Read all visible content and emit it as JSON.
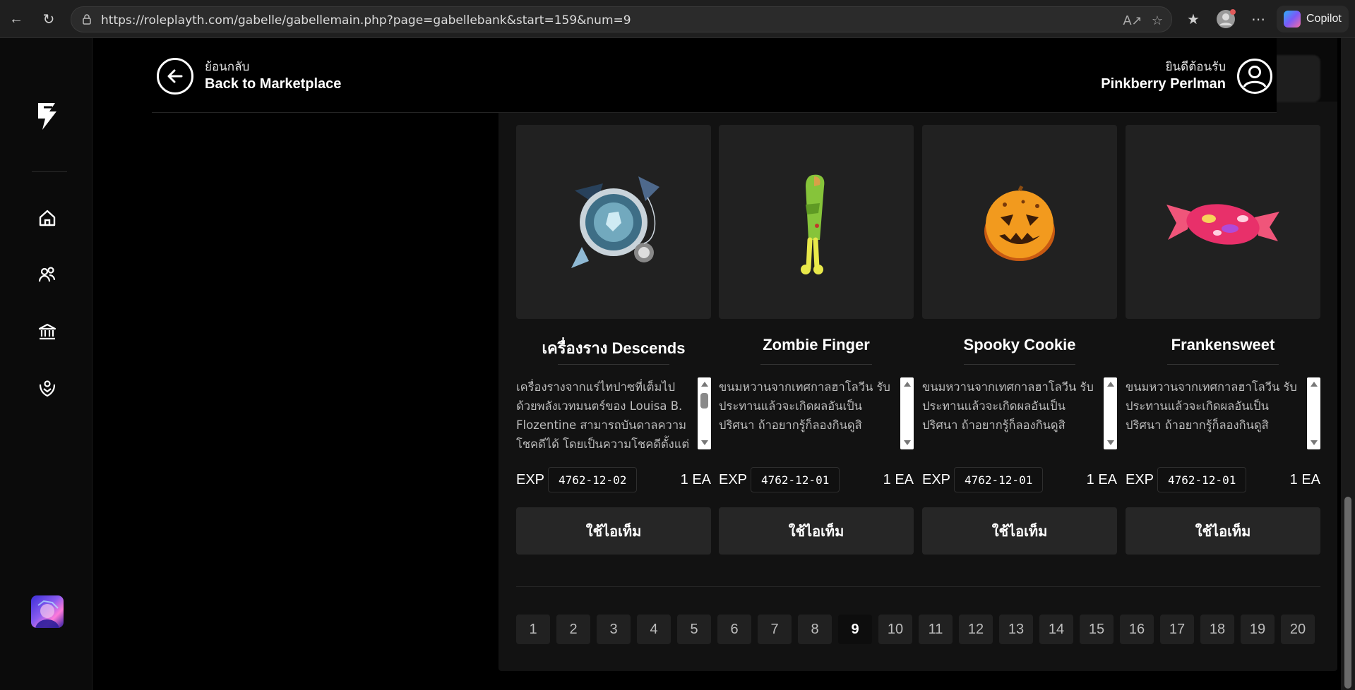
{
  "browser": {
    "url": "https://roleplayth.com/gabelle/gabellemain.php?page=gabellebank&start=159&num=9",
    "copilot_label": "Copilot"
  },
  "header": {
    "back_small": "ย้อนกลับ",
    "back_big": "Back to Marketplace",
    "welcome_small": "ยินดีต้อนรับ",
    "user_name": "Pinkberry Perlman"
  },
  "items": [
    {
      "name": "เครื่องราง Descends",
      "description": "เครื่องรางจากแร่ไทปาซที่เต็มไปด้วยพลังเวทมนตร์ของ Louisa B. Flozentine สามารถบันดาลความโชคดีได้ โดยเป็นความโชคดีตั้งแต่",
      "exp_label": "EXP",
      "exp_date": "4762-12-02",
      "qty": "1 EA",
      "use_label": "ใช้ไอเท็ม",
      "icon": "charm-icon"
    },
    {
      "name": "Zombie Finger",
      "description": "ขนมหวานจากเทศกาลฮาโลวีน รับประทานแล้วจะเกิดผลอันเป็นปริศนา ถ้าอยากรู้ก็ลองกินดูสิ",
      "exp_label": "EXP",
      "exp_date": "4762-12-01",
      "qty": "1 EA",
      "use_label": "ใช้ไอเท็ม",
      "icon": "zombie-finger-icon"
    },
    {
      "name": "Spooky Cookie",
      "description": "ขนมหวานจากเทศกาลฮาโลวีน รับประทานแล้วจะเกิดผลอันเป็นปริศนา ถ้าอยากรู้ก็ลองกินดูสิ",
      "exp_label": "EXP",
      "exp_date": "4762-12-01",
      "qty": "1 EA",
      "use_label": "ใช้ไอเท็ม",
      "icon": "cookie-icon"
    },
    {
      "name": "Frankensweet",
      "description": "ขนมหวานจากเทศกาลฮาโลวีน รับประทานแล้วจะเกิดผลอันเป็นปริศนา ถ้าอยากรู้ก็ลองกินดูสิ",
      "exp_label": "EXP",
      "exp_date": "4762-12-01",
      "qty": "1 EA",
      "use_label": "ใช้ไอเท็ม",
      "icon": "candy-icon"
    }
  ],
  "pagination": {
    "pages": [
      "1",
      "2",
      "3",
      "4",
      "5",
      "6",
      "7",
      "8",
      "9",
      "10",
      "11",
      "12",
      "13",
      "14",
      "15",
      "16",
      "17",
      "18",
      "19",
      "20"
    ],
    "current": "9"
  },
  "colors": {
    "background": "#000000",
    "panel": "#121212",
    "card": "#212121",
    "button": "#262626",
    "text": "#ffffff",
    "muted_text": "#bcbcbc"
  }
}
